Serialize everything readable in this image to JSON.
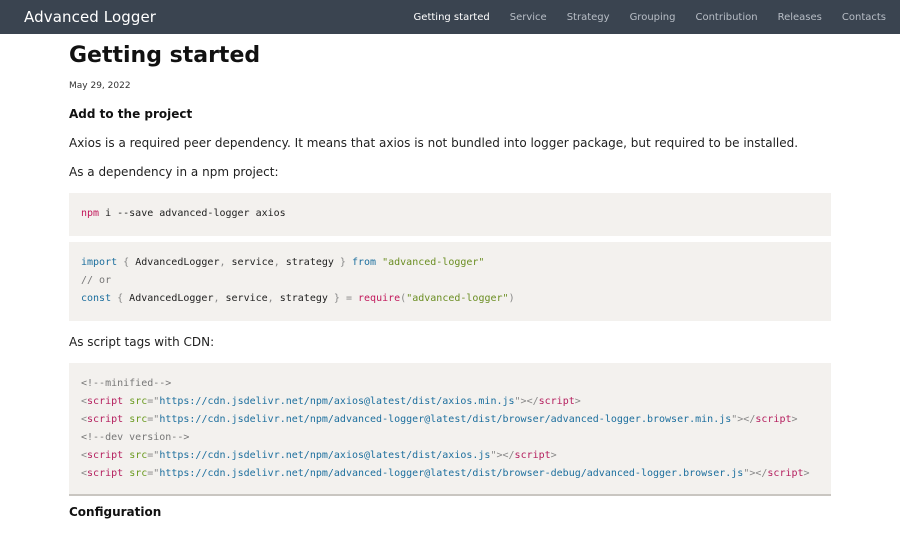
{
  "nav": {
    "brand": "Advanced Logger",
    "links": [
      "Getting started",
      "Service",
      "Strategy",
      "Grouping",
      "Contribution",
      "Releases",
      "Contacts"
    ]
  },
  "page": {
    "title": "Getting started",
    "date": "May 29, 2022",
    "section_add": "Add to the project",
    "p_axios": "Axios is a required peer dependency. It means that axios is not bundled into logger package, but required to be installed.",
    "p_npm": "As a dependency in a npm project:",
    "p_cdn": "As script tags with CDN:",
    "section_config": "Configuration"
  },
  "code1": {
    "cmd": "npm",
    "rest": " i --save advanced-logger axios"
  },
  "code2": {
    "l1_kw": "import",
    "l1_ob": " { ",
    "l1_a": "AdvancedLogger",
    "l1_c1": ", ",
    "l1_b": "service",
    "l1_c2": ", ",
    "l1_c": "strategy",
    "l1_cb": " } ",
    "l1_from": "from",
    "l1_sp": " ",
    "l1_str": "\"advanced-logger\"",
    "l2_comment": "// or",
    "l3_kw": "const",
    "l3_ob": " { ",
    "l3_a": "AdvancedLogger",
    "l3_c1": ", ",
    "l3_b": "service",
    "l3_c2": ", ",
    "l3_c": "strategy",
    "l3_cb": " } ",
    "l3_eq": "=",
    "l3_sp": " ",
    "l3_req": "require",
    "l3_po": "(",
    "l3_str": "\"advanced-logger\"",
    "l3_pc": ")"
  },
  "code3": {
    "comment_min": "<!--minified-->",
    "comment_dev": "<!--dev version-->",
    "lt": "<",
    "tag": "script",
    "sp": " ",
    "attr": "src",
    "eq": "=",
    "q": "\"",
    "close": "\"></",
    "gt": ">",
    "urls": [
      "https://cdn.jsdelivr.net/npm/axios@latest/dist/axios.min.js",
      "https://cdn.jsdelivr.net/npm/advanced-logger@latest/dist/browser/advanced-logger.browser.min.js",
      "https://cdn.jsdelivr.net/npm/axios@latest/dist/axios.js",
      "https://cdn.jsdelivr.net/npm/advanced-logger@latest/dist/browser-debug/advanced-logger.browser.js"
    ]
  }
}
